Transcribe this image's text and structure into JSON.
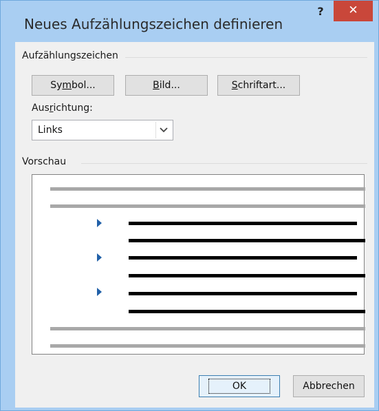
{
  "window": {
    "title": "Neues Aufzählungszeichen definieren",
    "help_label": "?",
    "close_label": "✕"
  },
  "bullet_group": {
    "label": "Aufzählungszeichen",
    "buttons": [
      {
        "pre": "Sy",
        "key": "m",
        "post": "bol..."
      },
      {
        "pre": "",
        "key": "B",
        "post": "ild..."
      },
      {
        "pre": "",
        "key": "S",
        "post": "chriftart..."
      }
    ]
  },
  "alignment": {
    "label_pre": "Aus",
    "label_key": "r",
    "label_post": "ichtung:",
    "selected": "Links"
  },
  "preview": {
    "label": "Vorschau"
  },
  "footer": {
    "ok_label": "OK",
    "cancel_label": "Abbrechen"
  },
  "colors": {
    "titlebar": "#a9cef2",
    "close": "#c9473a",
    "bullet": "#2160a8"
  }
}
